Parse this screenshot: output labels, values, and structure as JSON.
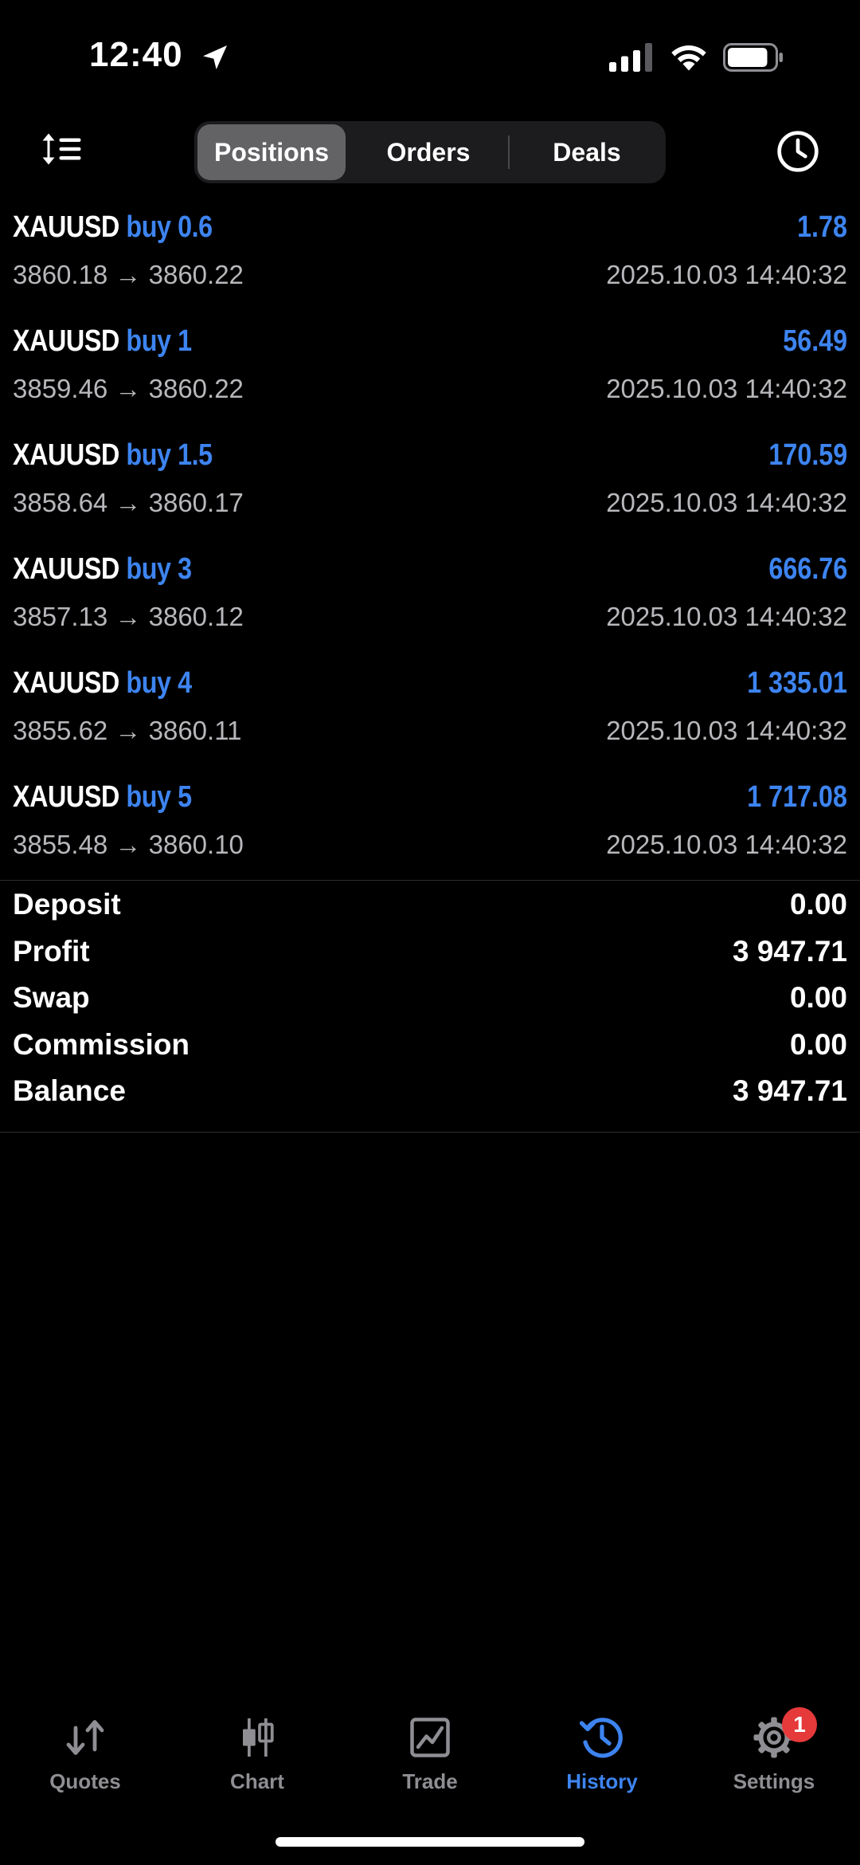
{
  "status_bar": {
    "time": "12:40"
  },
  "tabs_top": {
    "positions": "Positions",
    "orders": "Orders",
    "deals": "Deals"
  },
  "deals": [
    {
      "symbol": "XAUUSD",
      "side": "buy 0.6",
      "profit": "1.78",
      "prices": "3860.18 → 3860.22",
      "datetime": "2025.10.03 14:40:32"
    },
    {
      "symbol": "XAUUSD",
      "side": "buy 1",
      "profit": "56.49",
      "prices": "3859.46 → 3860.22",
      "datetime": "2025.10.03 14:40:32"
    },
    {
      "symbol": "XAUUSD",
      "side": "buy 1.5",
      "profit": "170.59",
      "prices": "3858.64 → 3860.17",
      "datetime": "2025.10.03 14:40:32"
    },
    {
      "symbol": "XAUUSD",
      "side": "buy 3",
      "profit": "666.76",
      "prices": "3857.13 → 3860.12",
      "datetime": "2025.10.03 14:40:32"
    },
    {
      "symbol": "XAUUSD",
      "side": "buy 4",
      "profit": "1 335.01",
      "prices": "3855.62 → 3860.11",
      "datetime": "2025.10.03 14:40:32"
    },
    {
      "symbol": "XAUUSD",
      "side": "buy 5",
      "profit": "1 717.08",
      "prices": "3855.48 → 3860.10",
      "datetime": "2025.10.03 14:40:32"
    }
  ],
  "summary": [
    {
      "label": "Deposit",
      "value": "0.00"
    },
    {
      "label": "Profit",
      "value": "3 947.71"
    },
    {
      "label": "Swap",
      "value": "0.00"
    },
    {
      "label": "Commission",
      "value": "0.00"
    },
    {
      "label": "Balance",
      "value": "3 947.71"
    }
  ],
  "tab_bar": {
    "quotes": "Quotes",
    "chart": "Chart",
    "trade": "Trade",
    "history": "History",
    "settings": "Settings",
    "settings_badge": "1"
  },
  "colors": {
    "accent": "#3d84f0",
    "badge": "#e5393a",
    "background": "#000000"
  }
}
